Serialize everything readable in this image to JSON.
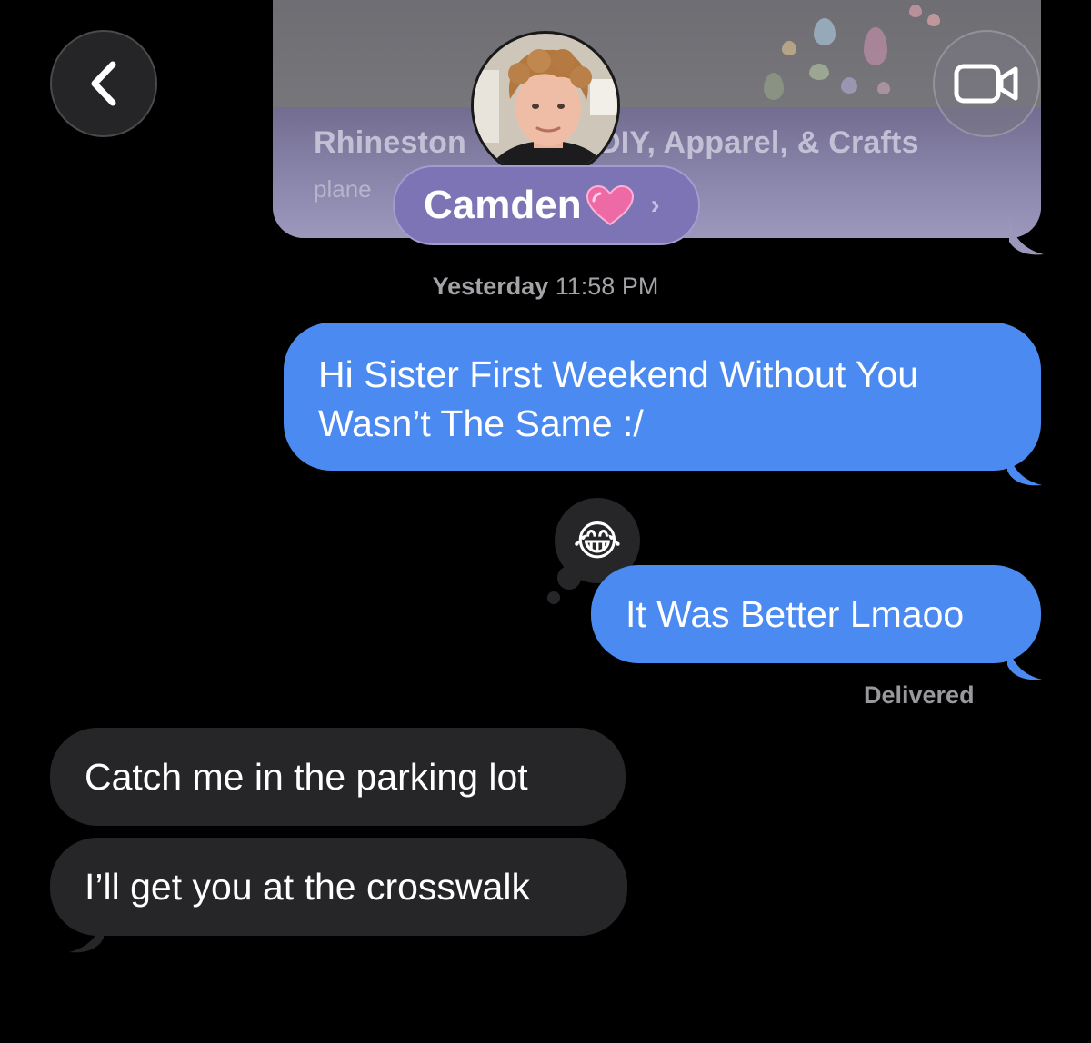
{
  "conversation": {
    "contact_name": "Camden",
    "contact_emoji": "💗",
    "contact_chevron": "›",
    "avatar_icon": "contact-photo"
  },
  "link_preview": {
    "title_left": "Rhineston",
    "title_right": "DIY, Apparel, & Crafts",
    "domain": "plane"
  },
  "nav": {
    "back_icon": "chevron-left",
    "video_icon": "video-camera"
  },
  "timestamp": {
    "day": "Yesterday",
    "time": "11:58 PM"
  },
  "messages": [
    {
      "direction": "sent",
      "text_line1": "Hi Sister First Weekend Without You",
      "text_line2": "Wasn’t The Same :/"
    },
    {
      "direction": "sent",
      "text": "It Was Better Lmaoo",
      "tapback": "😂"
    },
    {
      "direction": "received",
      "text": "Catch me in the parking lot"
    },
    {
      "direction": "received",
      "text": "I’ll get you at the crosswalk"
    }
  ],
  "status": {
    "delivered": "Delivered"
  },
  "colors": {
    "sent_bubble": "#4b8af0",
    "received_bubble": "#262628",
    "background": "#000000",
    "name_pill": "#7c74b4"
  }
}
